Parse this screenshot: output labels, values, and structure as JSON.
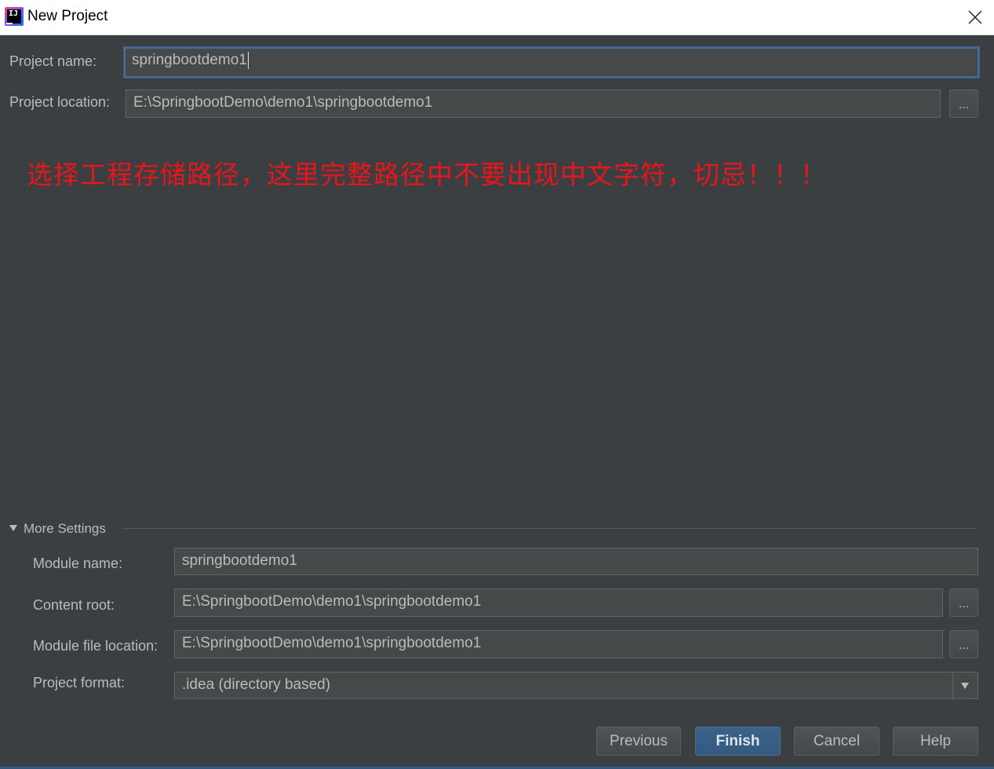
{
  "window": {
    "title": "New Project",
    "icon": "intellij-idea-icon",
    "close_icon": "close-icon"
  },
  "project": {
    "name_label": "Project name:",
    "name_value": "springbootdemo1",
    "location_label": "Project location:",
    "location_value": "E:\\SpringbootDemo\\demo1\\springbootdemo1",
    "browse_label": "..."
  },
  "annotation": {
    "text": "选择工程存储路径，这里完整路径中不要出现中文字符，切忌！！！",
    "color": "#e8151a"
  },
  "more_settings": {
    "toggle_label": "More Settings",
    "module_name_label": "Module name:",
    "module_name_value": "springbootdemo1",
    "content_root_label": "Content root:",
    "content_root_value": "E:\\SpringbootDemo\\demo1\\springbootdemo1",
    "module_file_label": "Module file location:",
    "module_file_value": "E:\\SpringbootDemo\\demo1\\springbootdemo1",
    "format_label": "Project format:",
    "format_value": ".idea (directory based)",
    "browse_label": "..."
  },
  "buttons": {
    "previous": "Previous",
    "finish": "Finish",
    "cancel": "Cancel",
    "help": "Help"
  },
  "colors": {
    "background": "#3c3f41",
    "field": "#45494a",
    "focus": "#466d94",
    "primary_button": "#365880"
  }
}
